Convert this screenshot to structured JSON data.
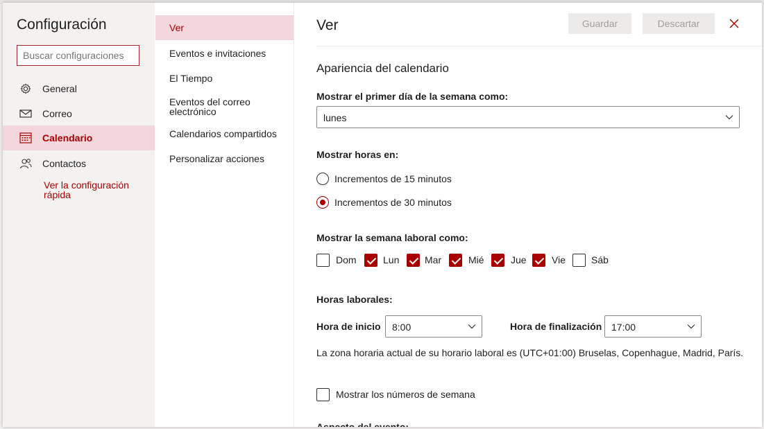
{
  "settings": {
    "title": "Configuración",
    "search_placeholder": "Buscar configuraciones",
    "nav": [
      {
        "label": "General",
        "icon": "gear-icon"
      },
      {
        "label": "Correo",
        "icon": "mail-icon"
      },
      {
        "label": "Calendario",
        "icon": "calendar-icon",
        "active": true
      },
      {
        "label": "Contactos",
        "icon": "people-icon"
      }
    ],
    "quick_link": "Ver la configuración rápida"
  },
  "subnav": [
    {
      "label": "Ver",
      "active": true
    },
    {
      "label": "Eventos e invitaciones"
    },
    {
      "label": "El Tiempo"
    },
    {
      "label": "Eventos del correo electrónico"
    },
    {
      "label": "Calendarios compartidos"
    },
    {
      "label": "Personalizar acciones"
    }
  ],
  "main": {
    "title": "Ver",
    "save_label": "Guardar",
    "discard_label": "Descartar",
    "section_title": "Apariencia del calendario",
    "first_day_label": "Mostrar el primer día de la semana como:",
    "first_day_value": "lunes",
    "hours_label": "Mostrar horas en:",
    "hours_options": [
      {
        "label": "Incrementos de 15 minutos",
        "selected": false
      },
      {
        "label": "Incrementos de 30 minutos",
        "selected": true
      }
    ],
    "work_week_label": "Mostrar la semana laboral como:",
    "work_days": [
      {
        "label": "Dom",
        "checked": false
      },
      {
        "label": "Lun",
        "checked": true
      },
      {
        "label": "Mar",
        "checked": true
      },
      {
        "label": "Mié",
        "checked": true
      },
      {
        "label": "Jue",
        "checked": true
      },
      {
        "label": "Vie",
        "checked": true
      },
      {
        "label": "Sáb",
        "checked": false
      }
    ],
    "work_hours_label": "Horas laborales:",
    "start_label": "Hora de inicio",
    "start_value": "8:00",
    "end_label": "Hora de finalización",
    "end_value": "17:00",
    "timezone_note": "La zona horaria actual de su horario laboral es (UTC+01:00) Bruselas, Copenhague, Madrid, París.",
    "week_numbers_label": "Mostrar los números de semana",
    "week_numbers_checked": false,
    "next_section_cut": "Aspecto del evento:"
  },
  "colors": {
    "accent": "#a80000",
    "nav_bg": "#f3f2f1",
    "active_bg": "#f4d7dc"
  }
}
